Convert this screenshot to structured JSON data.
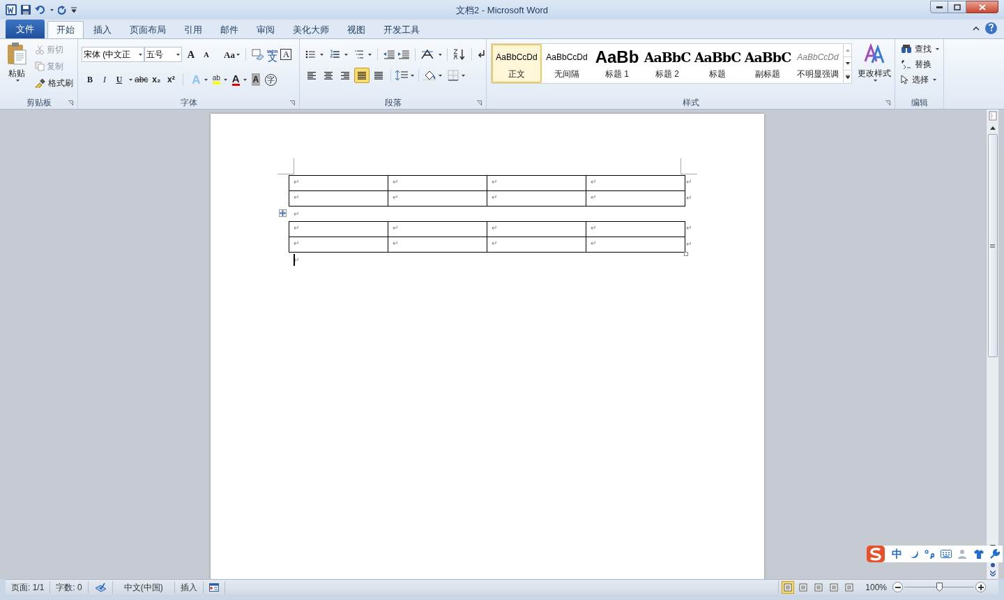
{
  "window": {
    "title": "文档2  -  Microsoft Word"
  },
  "tabs": [
    {
      "label": "文件",
      "kind": "file",
      "selected": false
    },
    {
      "label": "开始",
      "kind": "tab",
      "selected": true
    },
    {
      "label": "插入",
      "kind": "tab",
      "selected": false
    },
    {
      "label": "页面布局",
      "kind": "tab",
      "selected": false
    },
    {
      "label": "引用",
      "kind": "tab",
      "selected": false
    },
    {
      "label": "邮件",
      "kind": "tab",
      "selected": false
    },
    {
      "label": "审阅",
      "kind": "tab",
      "selected": false
    },
    {
      "label": "美化大师",
      "kind": "tab",
      "selected": false
    },
    {
      "label": "视图",
      "kind": "tab",
      "selected": false
    },
    {
      "label": "开发工具",
      "kind": "tab",
      "selected": false
    }
  ],
  "clipboard": {
    "group": "剪贴板",
    "paste": "粘贴",
    "items": [
      {
        "label": "剪切",
        "disabled": true
      },
      {
        "label": "复制",
        "disabled": true
      },
      {
        "label": "格式刷",
        "disabled": false
      }
    ]
  },
  "font": {
    "group": "字体",
    "font_name": "宋体 (中文正",
    "font_size": "五号",
    "grow": "A",
    "shrink": "A",
    "change_case": "Aa",
    "border_char": "A",
    "phonetic": "wén",
    "phonetic_char": "文",
    "format_buttons": [
      {
        "text": "B",
        "kind": "bold"
      },
      {
        "text": "I",
        "kind": "italic"
      },
      {
        "text": "U",
        "kind": "underline"
      },
      {
        "text": "abc",
        "kind": "strike"
      },
      {
        "text": "x₂",
        "kind": "sub"
      },
      {
        "text": "x²",
        "kind": "sup"
      }
    ],
    "effects": [
      {
        "text": "A",
        "kind": "effect"
      },
      {
        "text": "ab",
        "kind": "highlight"
      },
      {
        "text": "A",
        "kind": "color"
      },
      {
        "text": "A",
        "kind": "shade"
      },
      {
        "text": "字",
        "kind": "enclose"
      }
    ]
  },
  "paragraph": {
    "group": "段落",
    "alignments": [
      {
        "selected": false
      },
      {
        "selected": false
      },
      {
        "selected": false
      },
      {
        "selected": true
      },
      {
        "selected": false
      }
    ]
  },
  "styles": {
    "group": "样式",
    "items": [
      {
        "sample": "AaBbCcDd",
        "name": "正文",
        "kind": "normal",
        "selected": true
      },
      {
        "sample": "AaBbCcDd",
        "name": "无间隔",
        "kind": "normal",
        "selected": false
      },
      {
        "sample": "AaBb",
        "name": "标题 1",
        "kind": "heading1",
        "selected": false
      },
      {
        "sample": "AaBbC",
        "name": "标题 2",
        "kind": "heading",
        "selected": false
      },
      {
        "sample": "AaBbC",
        "name": "标题",
        "kind": "heading",
        "selected": false
      },
      {
        "sample": "AaBbC",
        "name": "副标题",
        "kind": "heading",
        "selected": false
      },
      {
        "sample": "AaBbCcDd",
        "name": "不明显强调",
        "kind": "emphasis",
        "selected": false
      }
    ],
    "change_styles": "更改样式"
  },
  "editing": {
    "group": "编辑",
    "items": [
      {
        "label": "查找",
        "dropdown": true
      },
      {
        "label": "替换",
        "dropdown": false
      },
      {
        "label": "选择",
        "dropdown": true
      }
    ]
  },
  "document": {
    "blocks": [
      {
        "kind": "table",
        "rows": [
          {
            "cells": [
              "↵",
              "↵",
              "↵",
              "↵"
            ],
            "end": "↵"
          },
          {
            "cells": [
              "↵",
              "↵",
              "↵",
              "↵"
            ],
            "end": "↵"
          }
        ]
      },
      {
        "kind": "paragraph",
        "text": "↵"
      },
      {
        "kind": "table",
        "rows": [
          {
            "cells": [
              "↵",
              "↵",
              "↵",
              "↵"
            ],
            "end": "↵"
          },
          {
            "cells": [
              "↵",
              "↵",
              "↵",
              "↵"
            ],
            "end": "↵"
          }
        ]
      },
      {
        "kind": "paragraph",
        "text": "↵",
        "cursor": true
      }
    ]
  },
  "ime_bar": {
    "mode": "中"
  },
  "status_bar": {
    "page": "页面: 1/1",
    "words": "字数: 0",
    "language": "中文(中国)",
    "mode": "插入",
    "views": [
      {
        "selected": true
      },
      {
        "selected": false
      },
      {
        "selected": false
      },
      {
        "selected": false
      },
      {
        "selected": false
      }
    ],
    "zoom": "100%",
    "zoom_slider": {
      "level": 0.5
    }
  }
}
